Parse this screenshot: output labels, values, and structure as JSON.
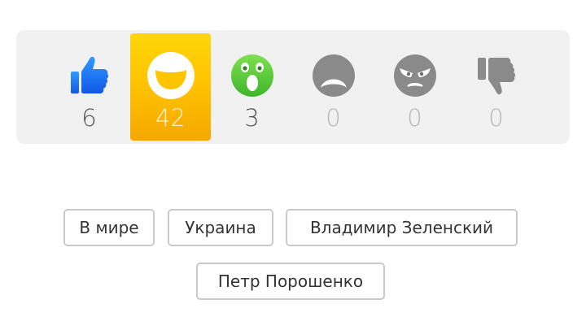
{
  "reactions": [
    {
      "name": "like",
      "icon": "thumbs-up-icon",
      "count": "6",
      "color": "#1877f2"
    },
    {
      "name": "laugh",
      "icon": "laughing-face-icon",
      "count": "42",
      "active": true,
      "color": "#ffc400"
    },
    {
      "name": "wow",
      "icon": "surprised-face-icon",
      "count": "3",
      "color": "#5cc93b"
    },
    {
      "name": "sad",
      "icon": "sad-face-icon",
      "count": "0",
      "color": "#888888"
    },
    {
      "name": "angry",
      "icon": "angry-face-icon",
      "count": "0",
      "color": "#888888"
    },
    {
      "name": "dislike",
      "icon": "thumbs-down-icon",
      "count": "0",
      "color": "#888888"
    }
  ],
  "tags": [
    {
      "label": "В мире"
    },
    {
      "label": "Украина"
    },
    {
      "label": "Владимир Зеленский"
    },
    {
      "label": "Петр Порошенко"
    }
  ]
}
